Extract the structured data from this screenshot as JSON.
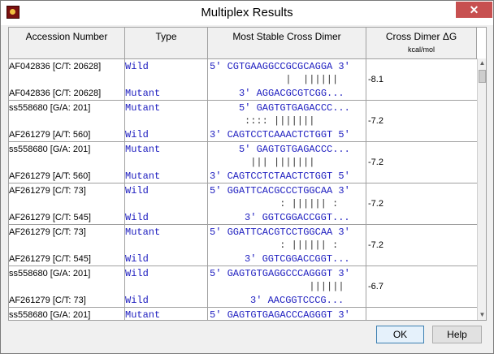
{
  "window": {
    "title": "Multiplex Results",
    "close_glyph": "✕",
    "icon": "app-icon"
  },
  "columns": [
    "Accession Number",
    "Type",
    "Most Stable Cross Dimer",
    "Cross Dimer ΔG"
  ],
  "dg_unit": "kcal/mol",
  "rows": [
    {
      "acc_top": "AF042836 [C/T: 20628]",
      "type_top": "Wild",
      "acc_bottom": "AF042836 [C/T: 20628]",
      "type_bottom": "Mutant",
      "seq_top": "5' CGTGAAGGCCGCGCAGGA 3'",
      "match": "  |  ||||||",
      "seq_bottom": "3' AGGACGCGTCGG...",
      "dg": "-8.1"
    },
    {
      "acc_top": "ss558680 [G/A: 201]",
      "type_top": "Mutant",
      "acc_bottom": "AF261279 [A/T: 560]",
      "type_bottom": "Wild",
      "seq_top": "5' GAGTGTGAGACCC...",
      "match": ":::: |||||||",
      "seq_bottom": "3' CAGTCCTCAAACTCTGGT 5'",
      "dg": "-7.2"
    },
    {
      "acc_top": "ss558680 [G/A: 201]",
      "type_top": "Mutant",
      "acc_bottom": "AF261279 [A/T: 560]",
      "type_bottom": "Mutant",
      "seq_top": "5' GAGTGTGAGACCC...",
      "match": " ||| |||||||",
      "seq_bottom": "3' CAGTCCTCTAACTCTGGT 5'",
      "dg": "-7.2"
    },
    {
      "acc_top": "AF261279 [C/T: 73]",
      "type_top": "Wild",
      "acc_bottom": "AF261279 [C/T: 545]",
      "type_bottom": "Wild",
      "seq_top": "5' GGATTCACGCCCTGGCAA 3'",
      "match": " : |||||| :",
      "seq_bottom": "3' GGTCGGACCGGT...",
      "dg": "-7.2"
    },
    {
      "acc_top": "AF261279 [C/T: 73]",
      "type_top": "Mutant",
      "acc_bottom": "AF261279 [C/T: 545]",
      "type_bottom": "Wild",
      "seq_top": "5' GGATTCACGTCCTGGCAA 3'",
      "match": " : |||||| :",
      "seq_bottom": "3' GGTCGGACCGGT...",
      "dg": "-7.2"
    },
    {
      "acc_top": "ss558680 [G/A: 201]",
      "type_top": "Wild",
      "acc_bottom": "AF261279 [C/T: 73]",
      "type_bottom": "Wild",
      "seq_top": "5' GAGTGTGAGGCCCAGGGT 3'",
      "match": "  ||||||",
      "seq_bottom": "3' AACGGTCCCG...",
      "dg": "-6.7"
    },
    {
      "acc_top": "ss558680 [G/A: 201]",
      "type_top": "Mutant",
      "acc_bottom": "",
      "type_bottom": "",
      "seq_top": "5' GAGTGTGAGACCCAGGGT 3'",
      "match": "",
      "seq_bottom": "",
      "dg": ""
    }
  ],
  "buttons": {
    "ok": "OK",
    "help": "Help"
  },
  "scroll": {
    "up": "▲",
    "down": "▼"
  }
}
